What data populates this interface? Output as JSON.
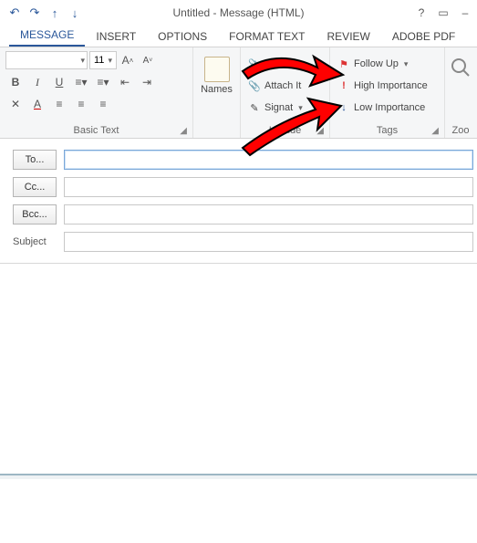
{
  "title": "Untitled - Message (HTML)",
  "qat": {
    "undo": "↶",
    "redo": "↷",
    "up": "↑",
    "down": "↓"
  },
  "help_icon": "?",
  "ribbon_collapse_icon": "▭",
  "min_icon": "–",
  "tabs": {
    "message": "MESSAGE",
    "insert": "INSERT",
    "options": "OPTIONS",
    "format_text": "FORMAT TEXT",
    "review": "REVIEW",
    "adobe_pdf": "ADOBE PDF"
  },
  "basic_text": {
    "label": "Basic Text",
    "font_name": "",
    "font_size": "11",
    "grow": "A",
    "shrink": "A",
    "bold": "B",
    "italic": "I",
    "underline": "U",
    "clear_fmt": "A",
    "font_color": "A"
  },
  "names_group": {
    "label": "Names",
    "names_btn": "Names"
  },
  "include_group": {
    "label": "Include",
    "attach_file": "Att",
    "attach_item": "Attach It",
    "signature": "Signat"
  },
  "tags_group": {
    "label": "Tags",
    "follow_up": "Follow Up",
    "high_importance": "High Importance",
    "low_importance": "Low Importance"
  },
  "zoom_group": {
    "label": "Zoo"
  },
  "fields": {
    "to_btn": "To...",
    "cc_btn": "Cc...",
    "bcc_btn": "Bcc...",
    "subject_label": "Subject",
    "to_val": "",
    "cc_val": "",
    "bcc_val": "",
    "subject_val": ""
  },
  "colors": {
    "accent": "#2a579a",
    "arrow": "#ff0000"
  }
}
